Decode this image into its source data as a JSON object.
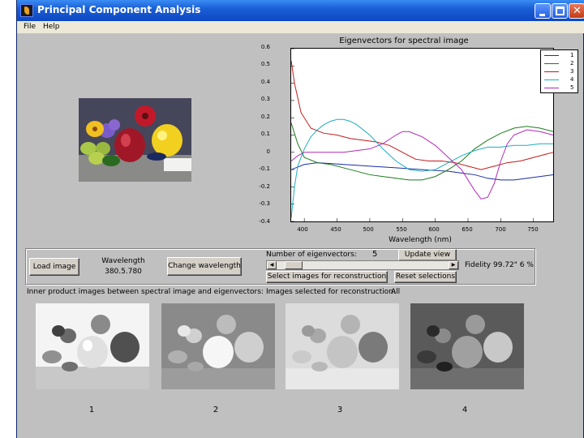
{
  "window": {
    "title": "Principal Component Analysis",
    "colors": {
      "titlebar": "#0d47c1",
      "face": "#c0c0c0"
    }
  },
  "menu": {
    "file": "File",
    "help": "Help"
  },
  "plot": {
    "title": "Eigenvectors for spectral image",
    "xlabel": "Wavelength (nm)"
  },
  "chart_data": {
    "type": "line",
    "title": "Eigenvectors for spectral image",
    "xlabel": "Wavelength (nm)",
    "ylabel": "",
    "xlim": [
      380,
      780
    ],
    "ylim": [
      -0.4,
      0.6
    ],
    "x_ticks": [
      400,
      450,
      500,
      550,
      600,
      650,
      700,
      750
    ],
    "y_ticks": [
      -0.4,
      -0.3,
      -0.2,
      -0.1,
      0,
      0.1,
      0.2,
      0.3,
      0.4,
      0.5,
      0.6
    ],
    "y_tick_labels": [
      "-0.4",
      "-0.3",
      "-0.2",
      "-0.1",
      "0",
      "0.1",
      "0.2",
      "0.3",
      "0.4",
      "0.5",
      "0.6"
    ],
    "legend_position": "top-right",
    "series": [
      {
        "name": "1",
        "color": "#1a2da8",
        "x": [
          380,
          400,
          420,
          440,
          460,
          480,
          500,
          520,
          540,
          560,
          580,
          600,
          620,
          640,
          660,
          680,
          700,
          720,
          740,
          760,
          780
        ],
        "y": [
          -0.1,
          -0.07,
          -0.06,
          -0.065,
          -0.07,
          -0.075,
          -0.08,
          -0.085,
          -0.09,
          -0.095,
          -0.1,
          -0.105,
          -0.11,
          -0.12,
          -0.13,
          -0.15,
          -0.16,
          -0.16,
          -0.15,
          -0.14,
          -0.13
        ]
      },
      {
        "name": "2",
        "color": "#1e7a1e",
        "x": [
          380,
          390,
          400,
          420,
          440,
          460,
          480,
          500,
          520,
          540,
          560,
          580,
          600,
          620,
          640,
          660,
          680,
          700,
          720,
          740,
          760,
          780
        ],
        "y": [
          0.17,
          0.05,
          -0.03,
          -0.06,
          -0.07,
          -0.09,
          -0.11,
          -0.13,
          -0.14,
          -0.15,
          -0.16,
          -0.16,
          -0.14,
          -0.1,
          -0.05,
          0.02,
          0.07,
          0.11,
          0.14,
          0.15,
          0.14,
          0.12
        ]
      },
      {
        "name": "3",
        "color": "#c21a1a",
        "x": [
          380,
          385,
          395,
          410,
          430,
          450,
          470,
          490,
          510,
          530,
          550,
          570,
          590,
          610,
          630,
          650,
          670,
          690,
          710,
          730,
          750,
          770,
          780
        ],
        "y": [
          0.53,
          0.4,
          0.23,
          0.14,
          0.11,
          0.1,
          0.08,
          0.07,
          0.06,
          0.04,
          0.0,
          -0.04,
          -0.05,
          -0.05,
          -0.06,
          -0.08,
          -0.1,
          -0.08,
          -0.06,
          -0.05,
          -0.03,
          -0.01,
          0.0
        ]
      },
      {
        "name": "4",
        "color": "#1aaec0",
        "x": [
          380,
          385,
          390,
          400,
          410,
          420,
          430,
          440,
          450,
          460,
          470,
          480,
          500,
          520,
          540,
          560,
          580,
          600,
          620,
          640,
          660,
          680,
          700,
          720,
          740,
          760,
          780
        ],
        "y": [
          -0.38,
          -0.2,
          -0.08,
          0.02,
          0.09,
          0.13,
          0.16,
          0.18,
          0.19,
          0.19,
          0.18,
          0.16,
          0.1,
          0.02,
          -0.05,
          -0.1,
          -0.11,
          -0.1,
          -0.06,
          -0.02,
          0.01,
          0.03,
          0.03,
          0.04,
          0.04,
          0.05,
          0.05
        ]
      },
      {
        "name": "5",
        "color": "#b32ab8",
        "x": [
          380,
          390,
          400,
          420,
          440,
          460,
          480,
          500,
          520,
          540,
          550,
          560,
          580,
          600,
          620,
          640,
          660,
          670,
          680,
          690,
          700,
          710,
          720,
          740,
          760,
          780
        ],
        "y": [
          -0.05,
          -0.02,
          0.0,
          0.0,
          0.0,
          0.0,
          0.01,
          0.02,
          0.05,
          0.1,
          0.12,
          0.12,
          0.09,
          0.04,
          -0.03,
          -0.1,
          -0.22,
          -0.27,
          -0.26,
          -0.18,
          -0.05,
          0.05,
          0.1,
          0.13,
          0.12,
          0.1
        ]
      }
    ]
  },
  "controls": {
    "load_label": "Load image",
    "wavelength_label": "Wavelength",
    "wavelength_value": "380.5.780",
    "change_label": "Change wavelength",
    "num_eig_label": "Number of eigenvectors:",
    "num_eig_value": "5",
    "update_label": "Update view",
    "slider_value": 0.05,
    "fidelity": "Fidelity 99.72\" 6 %",
    "select_label": "Select images for reconstruction",
    "reset_label": "Reset selections"
  },
  "images": {
    "inner_caption": "Inner product images between spectral image and eigenvectors:",
    "selected_caption": "Images selected for reconstruction:",
    "selected_value": "All",
    "labels": [
      "1",
      "2",
      "3",
      "4"
    ]
  }
}
